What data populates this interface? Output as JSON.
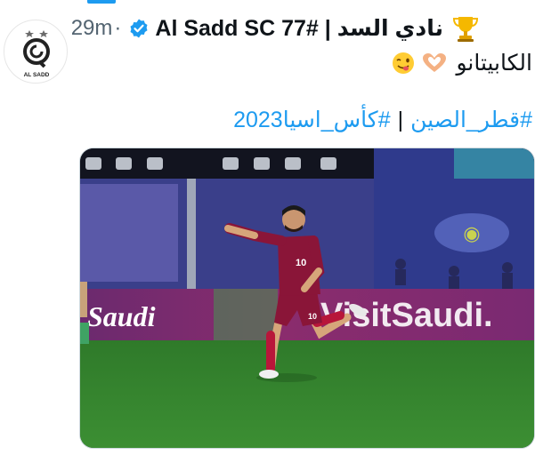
{
  "account": {
    "display_name": "نادي السد | #77 Al Sadd SC",
    "timestamp": "29m",
    "separator": "·",
    "avatar_logo_text": "AL SADD",
    "verified_icon": "verified-badge-icon",
    "name_emoji_icon": "trophy-icon"
  },
  "tweet": {
    "text": "الكابيتانو",
    "emojis": [
      "heart-hands-icon",
      "winking-face-tongue-icon"
    ],
    "hashtags": [
      "#قطر_الصين",
      "#كأس_اسيا2023"
    ],
    "hashtag_separator": "|"
  },
  "media": {
    "type": "photo",
    "description_icon": "photo",
    "player_number": "10",
    "ad_boards": [
      "Saudi",
      "VisitSaudi."
    ]
  },
  "colors": {
    "accent": "#1d9bf0",
    "text": "#0f1419",
    "muted": "#536471",
    "jersey": "#8a1538"
  }
}
